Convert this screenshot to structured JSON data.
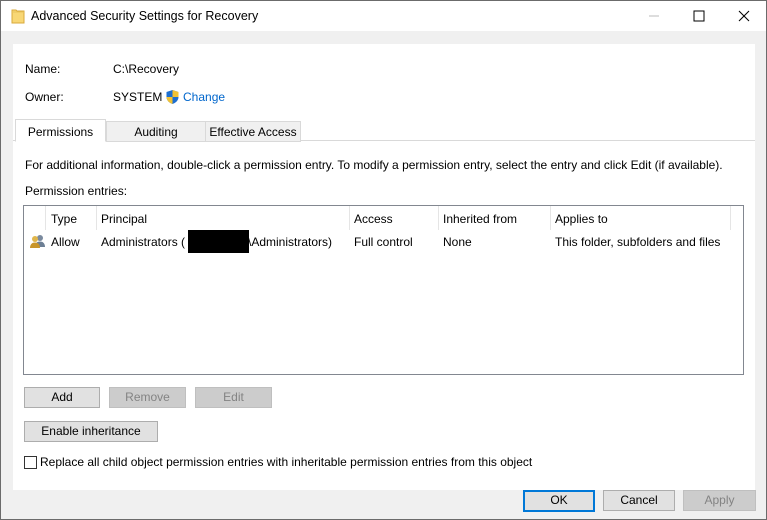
{
  "window": {
    "title": "Advanced Security Settings for Recovery"
  },
  "info": {
    "name_label": "Name:",
    "name_value": "C:\\Recovery",
    "owner_label": "Owner:",
    "owner_value": "SYSTEM",
    "change_link": "Change"
  },
  "tabs": [
    {
      "label": "Permissions",
      "active": true
    },
    {
      "label": "Auditing",
      "active": false
    },
    {
      "label": "Effective Access",
      "active": false
    }
  ],
  "permissions": {
    "description": "For additional information, double-click a permission entry. To modify a permission entry, select the entry and click Edit (if available).",
    "entries_label": "Permission entries:",
    "columns": [
      "Type",
      "Principal",
      "Access",
      "Inherited from",
      "Applies to"
    ],
    "rows": [
      {
        "type": "Allow",
        "principal_prefix": "Administrators (",
        "principal_suffix": "\\Administrators)",
        "access": "Full control",
        "inherited_from": "None",
        "applies_to": "This folder, subfolders and files"
      }
    ]
  },
  "buttons": {
    "add": "Add",
    "remove": "Remove",
    "edit": "Edit",
    "enable_inheritance": "Enable inheritance",
    "ok": "OK",
    "cancel": "Cancel",
    "apply": "Apply"
  },
  "replace_checkbox": {
    "label": "Replace all child object permission entries with inheritable permission entries from this object",
    "checked": false
  },
  "colors": {
    "link": "#0066cc",
    "accent": "#0078d7"
  }
}
